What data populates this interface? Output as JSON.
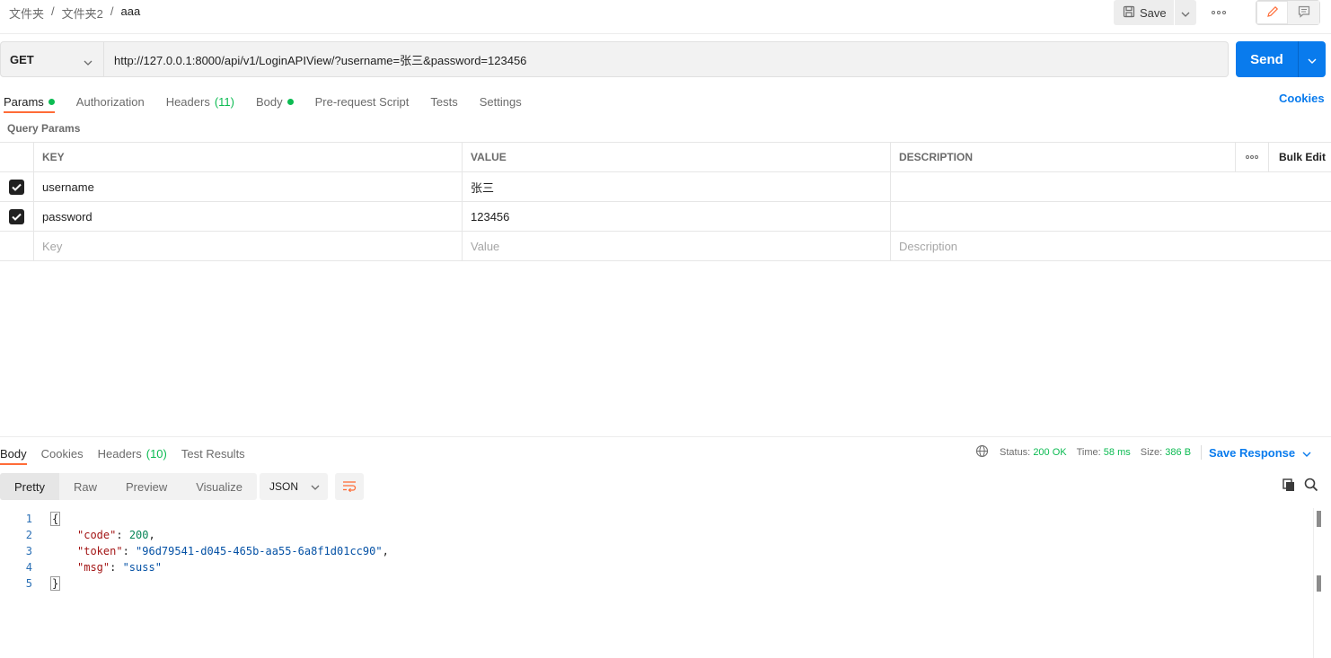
{
  "breadcrumb": {
    "folder1": "文件夹",
    "folder2": "文件夹2",
    "request": "aaa",
    "separator": "/"
  },
  "toolbar": {
    "save_label": "Save"
  },
  "request": {
    "method": "GET",
    "url": "http://127.0.0.1:8000/api/v1/LoginAPIView/?username=张三&password=123456",
    "send_label": "Send"
  },
  "request_tabs": {
    "params": "Params",
    "authorization": "Authorization",
    "headers": "Headers",
    "headers_count": "(11)",
    "body": "Body",
    "prerequest": "Pre-request Script",
    "tests": "Tests",
    "settings": "Settings",
    "cookies": "Cookies"
  },
  "query_params": {
    "title": "Query Params",
    "columns": {
      "key": "KEY",
      "value": "VALUE",
      "description": "DESCRIPTION",
      "bulk_edit": "Bulk Edit"
    },
    "rows": [
      {
        "key": "username",
        "value": "张三",
        "description": "",
        "checked": true
      },
      {
        "key": "password",
        "value": "123456",
        "description": "",
        "checked": true
      }
    ],
    "placeholders": {
      "key": "Key",
      "value": "Value",
      "description": "Description"
    }
  },
  "response_tabs": {
    "body": "Body",
    "cookies": "Cookies",
    "headers": "Headers",
    "headers_count": "(10)",
    "test_results": "Test Results"
  },
  "response_status": {
    "status_label": "Status:",
    "status_value": "200 OK",
    "time_label": "Time:",
    "time_value": "58 ms",
    "size_label": "Size:",
    "size_value": "386 B",
    "save_response": "Save Response"
  },
  "response_view": {
    "modes": [
      "Pretty",
      "Raw",
      "Preview",
      "Visualize"
    ],
    "format": "JSON"
  },
  "response_body": {
    "line_numbers": [
      "1",
      "2",
      "3",
      "4",
      "5"
    ],
    "open_brace": "{",
    "close_brace": "}",
    "code_key": "\"code\"",
    "code_value": "200",
    "token_key": "\"token\"",
    "token_value": "\"96d79541-d045-465b-aa55-6a8f1d01cc90\"",
    "msg_key": "\"msg\"",
    "msg_value": "\"suss\""
  },
  "colors": {
    "accent": "#ff6c37",
    "send": "#097bed",
    "success": "#0cbb52"
  }
}
